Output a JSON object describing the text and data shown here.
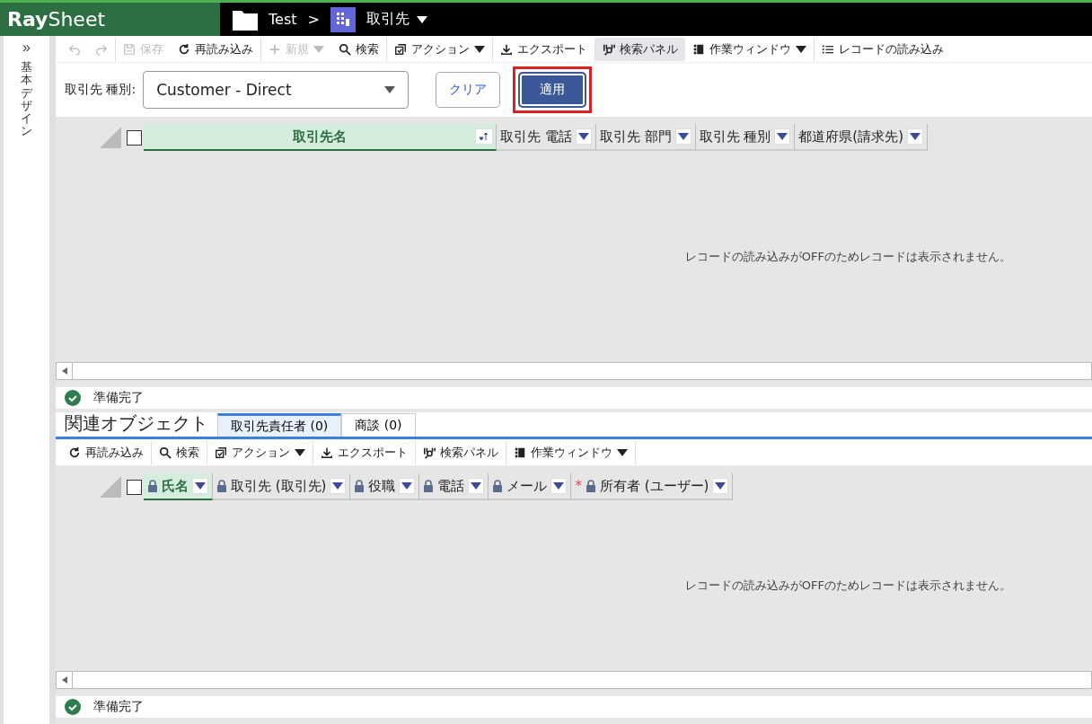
{
  "header": {
    "logo_bold": "Ray",
    "logo_light": "Sheet",
    "breadcrumb": [
      {
        "label": "Test",
        "dropdown": false
      },
      {
        "label": "取引先",
        "dropdown": true
      }
    ],
    "separator": ">"
  },
  "sidebar": {
    "title": "基本デザイン",
    "expand": "»"
  },
  "toolbar": [
    {
      "disabled": true,
      "dropdown": false,
      "pressed": false
    },
    {
      "disabled": true,
      "dropdown": false,
      "pressed": false
    },
    {
      "label": "保存",
      "disabled": true,
      "dropdown": false,
      "pressed": false
    },
    {
      "label": "再読み込み",
      "disabled": false,
      "dropdown": false,
      "pressed": false
    },
    {
      "label": "新規",
      "disabled": true,
      "dropdown": true,
      "pressed": false
    },
    {
      "label": "検索",
      "disabled": false,
      "dropdown": false,
      "pressed": false
    },
    {
      "label": "アクション",
      "disabled": false,
      "dropdown": true,
      "pressed": false
    },
    {
      "label": "エクスポート",
      "disabled": false,
      "dropdown": false,
      "pressed": false
    },
    {
      "label": "検索パネル",
      "disabled": false,
      "dropdown": false,
      "pressed": true
    },
    {
      "label": "作業ウィンドウ",
      "disabled": false,
      "dropdown": true,
      "pressed": false
    },
    {
      "label": "レコードの読み込み",
      "disabled": false,
      "dropdown": false,
      "pressed": false
    }
  ],
  "filter": {
    "label": "取引先 種別:",
    "value": "Customer - Direct",
    "buttons": [
      {
        "label": "クリア",
        "primary": false,
        "highlighted": false
      },
      {
        "label": "適用",
        "primary": true,
        "highlighted": true
      }
    ]
  },
  "grid": {
    "columns": [
      {
        "label": "取引先名",
        "selected": true
      },
      {
        "label": "取引先 電話",
        "selected": false
      },
      {
        "label": "取引先 部門",
        "selected": false
      },
      {
        "label": "取引先 種別",
        "selected": false
      },
      {
        "label": "都道府県(請求先)",
        "selected": false
      }
    ],
    "checked": false,
    "message": "レコードの読み込みがOFFのためレコードは表示されません。",
    "status": "準備完了"
  },
  "related": {
    "title": "関連オブジェクト",
    "tabs": [
      {
        "label": "取引先責任者 (0)",
        "selected": true
      },
      {
        "label": "商談 (0)",
        "selected": false
      }
    ],
    "toolbar": [
      {
        "label": "再読み込み",
        "dropdown": false
      },
      {
        "label": "検索",
        "dropdown": false
      },
      {
        "label": "アクション",
        "dropdown": true
      },
      {
        "label": "エクスポート",
        "dropdown": false
      },
      {
        "label": "検索パネル",
        "dropdown": false
      },
      {
        "label": "作業ウィンドウ",
        "dropdown": true
      }
    ],
    "grid": {
      "columns": [
        {
          "label": "氏名",
          "selected": true,
          "locked": true
        },
        {
          "label": "取引先 (取引先)",
          "selected": false,
          "locked": true
        },
        {
          "label": "役職",
          "selected": false,
          "locked": true
        },
        {
          "label": "電話",
          "selected": false,
          "locked": true
        },
        {
          "label": "メール",
          "selected": false,
          "locked": true
        },
        {
          "label": "所有者 (ユーザー)",
          "selected": false,
          "locked": true,
          "mark": "*"
        }
      ],
      "checked": false,
      "message": "レコードの読み込みがOFFのためレコードは表示されません。",
      "status": "準備完了"
    }
  }
}
